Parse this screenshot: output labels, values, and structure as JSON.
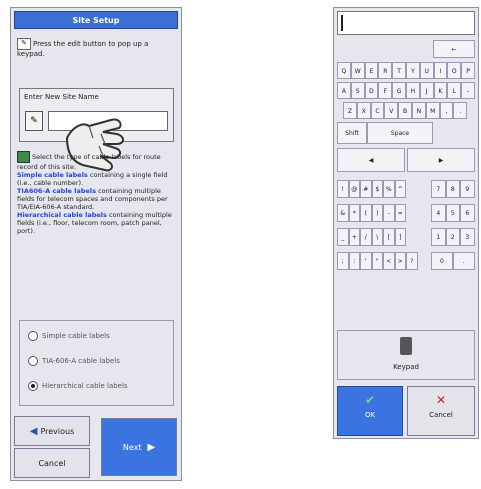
{
  "left_panel": {
    "title": "Site Setup",
    "instruction": "Press the edit button to pop up a keypad.",
    "site_label": "Enter New Site Name",
    "select_text": "Select the type of cable labels for route record of this site:",
    "simple": "Simple cable labels",
    "simple_desc": " containing a single field (i.e., cable number).",
    "tia": "TIA606-A cable labels",
    "tia_desc": " containing multiple fields for telecom spaces and components per TIA/EIA-606-A standard.",
    "hier": "Hierarchical cable labels",
    "hier_desc": " containing multiple fields (i.e., floor, telecom room, patch panel, port).",
    "options": [
      "Simple cable labels",
      "TIA-606-A cable labels",
      "Hierarchical cable labels"
    ],
    "selected_index": 2,
    "prev_label": "Previous",
    "cancel_label": "Cancel",
    "next_label": "Next"
  },
  "right_panel": {
    "input_value": "",
    "backspace": "←",
    "row1": [
      "Q",
      "W",
      "E",
      "R",
      "T",
      "Y",
      "U",
      "I",
      "O",
      "P"
    ],
    "row2": [
      "A",
      "S",
      "D",
      "F",
      "G",
      "H",
      "J",
      "K",
      "L",
      "-"
    ],
    "row3": [
      "Z",
      "X",
      "C",
      "V",
      "B",
      "N",
      "M",
      ",",
      "."
    ],
    "shift_label": "Shift",
    "space_label": "Space",
    "left_arrow": "◀",
    "right_arrow": "▶",
    "sym1": [
      "!",
      "@",
      "#",
      "$",
      "%",
      "^"
    ],
    "sym2": [
      "&",
      "*",
      "(",
      ")",
      "-",
      "="
    ],
    "sym3": [
      "_",
      "+",
      "/",
      "\\",
      "[",
      "]"
    ],
    "sym4": [
      ";",
      ":",
      "'",
      "\"",
      "<",
      ">",
      "?"
    ],
    "num1": [
      "7",
      "8",
      "9"
    ],
    "num2": [
      "4",
      "5",
      "6"
    ],
    "num3": [
      "1",
      "2",
      "3"
    ],
    "num4": [
      "0",
      "."
    ],
    "keypad_label": "Keypad",
    "ok_label": "OK",
    "cancel_label": "Cancel"
  }
}
